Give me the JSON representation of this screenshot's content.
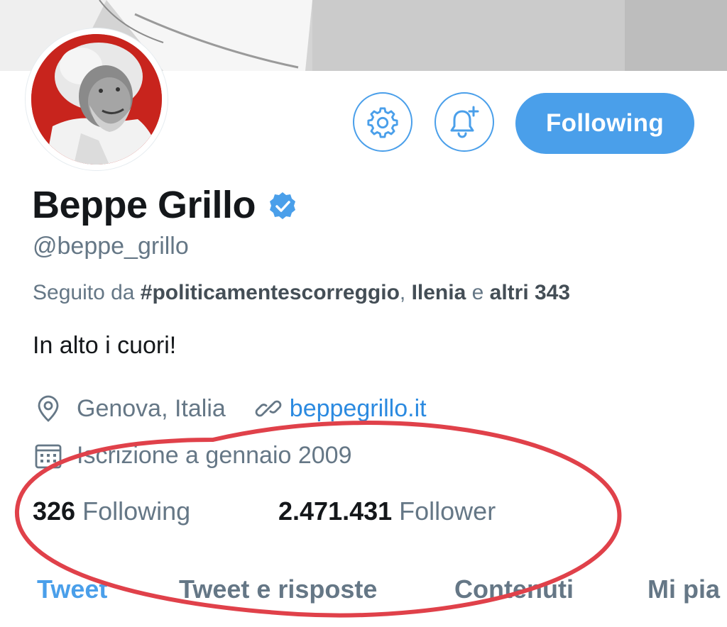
{
  "profile": {
    "name": "Beppe Grillo",
    "handle": "@beppe_grillo",
    "followed_by": {
      "prefix": "Seguito da ",
      "user1": "#politicamentescorreggio",
      "sep": ", ",
      "user2": "Ilenia",
      "joiner": " e ",
      "others": "altri 343"
    },
    "bio": "In alto i cuori!",
    "location": "Genova, Italia",
    "website": "beppegrillo.it",
    "joined": "Iscrizione a gennaio 2009"
  },
  "actions": {
    "following_label": "Following"
  },
  "stats": {
    "following_count": "326",
    "following_label": "Following",
    "followers_count": "2.471.431",
    "followers_label": "Follower"
  },
  "tabs": [
    {
      "label": "Tweet",
      "active": true
    },
    {
      "label": "Tweet e risposte",
      "active": false
    },
    {
      "label": "Contenuti",
      "active": false
    },
    {
      "label": "Mi pia",
      "active": false
    }
  ],
  "colors": {
    "accent": "#4a9fea",
    "annotation": "#e0414a"
  },
  "icons": [
    "settings-gear-icon",
    "bell-plus-icon",
    "verified-badge-icon",
    "location-pin-icon",
    "link-icon",
    "calendar-icon"
  ]
}
